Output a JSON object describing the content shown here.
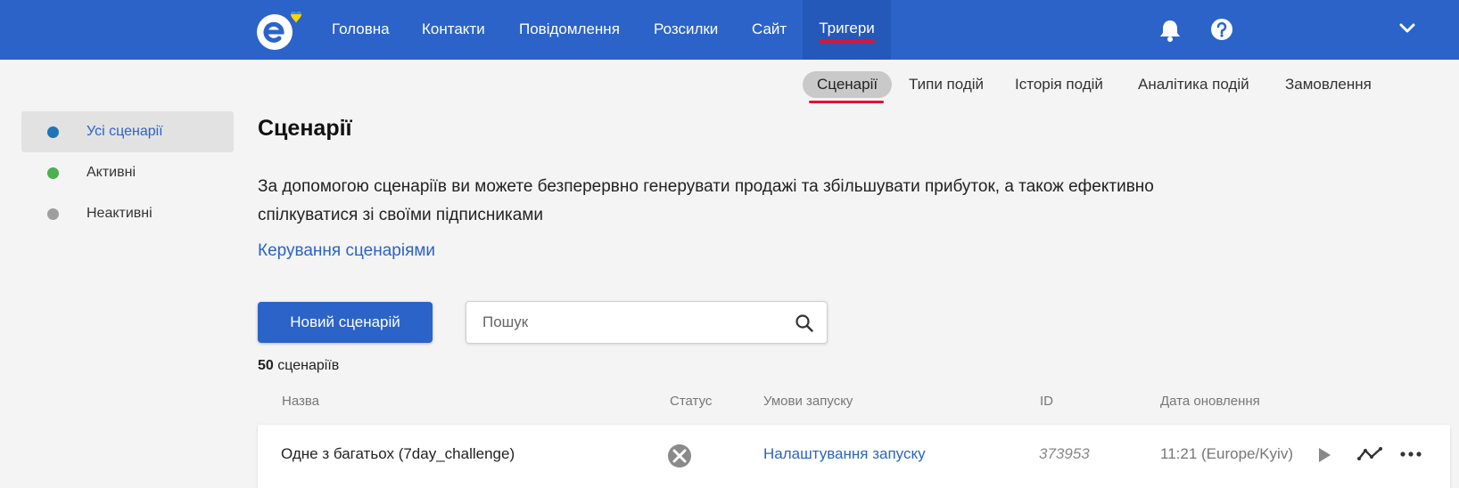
{
  "header": {
    "logo": "e-logo-with-heart",
    "nav": [
      "Головна",
      "Контакти",
      "Повідомлення",
      "Розсилки",
      "Сайт",
      "Тригери"
    ],
    "active_nav": "Тригери",
    "icons": [
      "bell-icon",
      "help-icon",
      "chevron-down-icon"
    ]
  },
  "subnav": {
    "items": [
      "Сценарії",
      "Типи подій",
      "Історія подій",
      "Аналітика подій",
      "Замовлення"
    ],
    "active": "Сценарії"
  },
  "sidebar": {
    "items": [
      {
        "label": "Усі сценарії",
        "dot_color": "#1f74b8"
      },
      {
        "label": "Активні",
        "dot_color": "#4caf50"
      },
      {
        "label": "Неактивні",
        "dot_color": "#9e9e9e"
      }
    ]
  },
  "main": {
    "title": "Сценарії",
    "description": "За допомогою сценаріїв ви можете безперервно генерувати продажі та збільшувати прибуток, а також ефективно спілкуватися зі своїми підписниками",
    "manage_link": "Керування сценаріями",
    "new_button": "Новий сценарій",
    "search_placeholder": "Пошук",
    "count_number": "50",
    "count_label": "сценаріїв"
  },
  "table": {
    "columns": [
      "Назва",
      "Статус",
      "Умови запуску",
      "ID",
      "Дата оновлення"
    ],
    "rows": [
      {
        "name": "Одне з багатьох (7day_challenge)",
        "status_icon": "status-disabled-icon",
        "launch": "Налаштування запуску",
        "id": "373953",
        "date": "11:21 (Europe/Kyiv)"
      }
    ]
  },
  "colors": {
    "header": "#2b63c9",
    "accent": "#2b63c9",
    "active_underline": "#e8102e"
  }
}
